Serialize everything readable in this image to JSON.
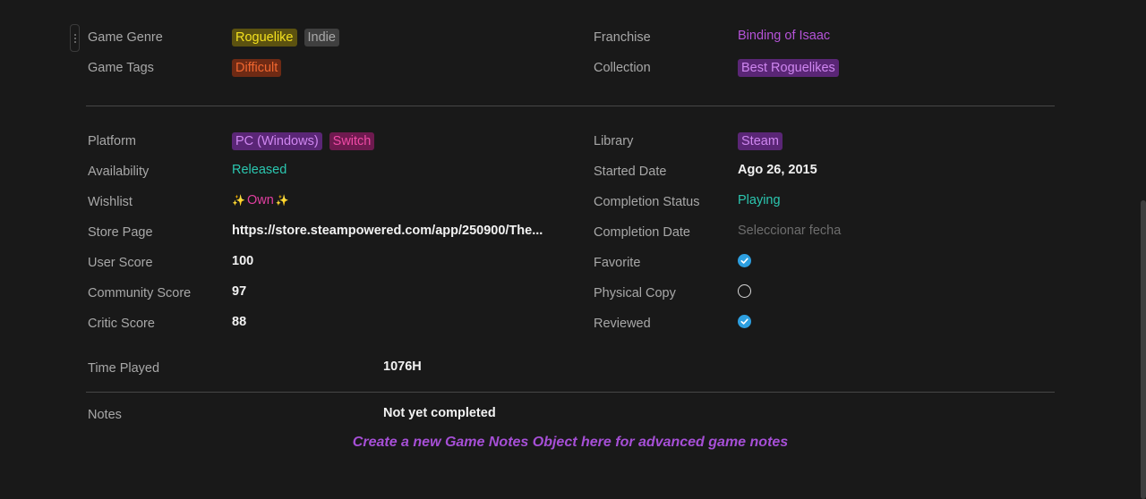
{
  "section1": {
    "genre": {
      "label": "Game Genre",
      "tags": [
        {
          "text": "Roguelike",
          "bg": "#5c5210",
          "fg": "#f3e01e"
        },
        {
          "text": "Indie",
          "bg": "#3f3f3f",
          "fg": "#a9a9a9"
        }
      ]
    },
    "tags": {
      "label": "Game Tags",
      "tags": [
        {
          "text": "Difficult",
          "bg": "#6e2a14",
          "fg": "#f0662f"
        }
      ]
    },
    "franchise": {
      "label": "Franchise",
      "value": "Binding of Isaac"
    },
    "collection": {
      "label": "Collection",
      "tags": [
        {
          "text": "Best Roguelikes",
          "bg": "#5a2676",
          "fg": "#cf86f0"
        }
      ]
    }
  },
  "section2": {
    "platform": {
      "label": "Platform",
      "tags": [
        {
          "text": "PC (Windows)",
          "bg": "#5a2676",
          "fg": "#cf86f0"
        },
        {
          "text": "Switch",
          "bg": "#6e1a4f",
          "fg": "#f04aa6"
        }
      ]
    },
    "availability": {
      "label": "Availability",
      "value": "Released"
    },
    "wishlist": {
      "label": "Wishlist",
      "value": "Own",
      "sparkle": "✨"
    },
    "store_page": {
      "label": "Store Page",
      "value": "https://store.steampowered.com/app/250900/The..."
    },
    "user_score": {
      "label": "User Score",
      "value": "100"
    },
    "community_score": {
      "label": "Community Score",
      "value": "97"
    },
    "critic_score": {
      "label": "Critic Score",
      "value": "88"
    },
    "library": {
      "label": "Library",
      "tags": [
        {
          "text": "Steam",
          "bg": "#5a2676",
          "fg": "#cf86f0"
        }
      ]
    },
    "started_date": {
      "label": "Started Date",
      "value": "Ago 26, 2015"
    },
    "completion_status": {
      "label": "Completion Status",
      "value": "Playing"
    },
    "completion_date": {
      "label": "Completion Date",
      "placeholder": "Seleccionar fecha"
    },
    "favorite": {
      "label": "Favorite",
      "checked": true
    },
    "physical_copy": {
      "label": "Physical Copy",
      "checked": false
    },
    "reviewed": {
      "label": "Reviewed",
      "checked": true
    }
  },
  "time_played": {
    "label": "Time Played",
    "value": "1076H"
  },
  "notes": {
    "label": "Notes",
    "value": "Not yet completed"
  },
  "footer_link": "Create a new Game Notes Object here for advanced game notes"
}
